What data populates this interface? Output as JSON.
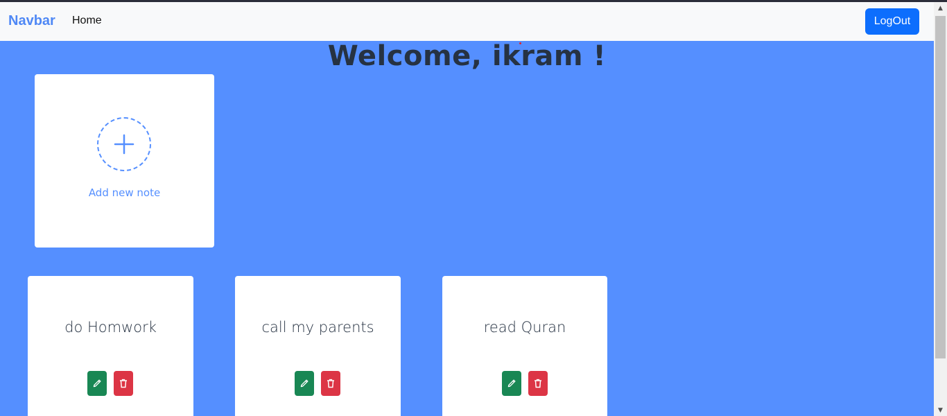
{
  "navbar": {
    "brand": "Navbar",
    "home_label": "Home",
    "logout_label": "LogOut"
  },
  "welcome": {
    "text": "Welcome, ikram !"
  },
  "add_note": {
    "label": "Add new note",
    "icon": "plus-icon"
  },
  "notes": [
    {
      "title": "do Homwork"
    },
    {
      "title": "call my parents"
    },
    {
      "title": "read Quran"
    }
  ],
  "note_actions": {
    "edit_icon": "pencil-icon",
    "delete_icon": "trash-icon"
  },
  "colors": {
    "page_background": "#558fff",
    "brand": "#4f88f5",
    "logout_button": "#0d6efd",
    "edit_button": "#198754",
    "delete_button": "#dc3545",
    "heading_text": "#263242"
  }
}
